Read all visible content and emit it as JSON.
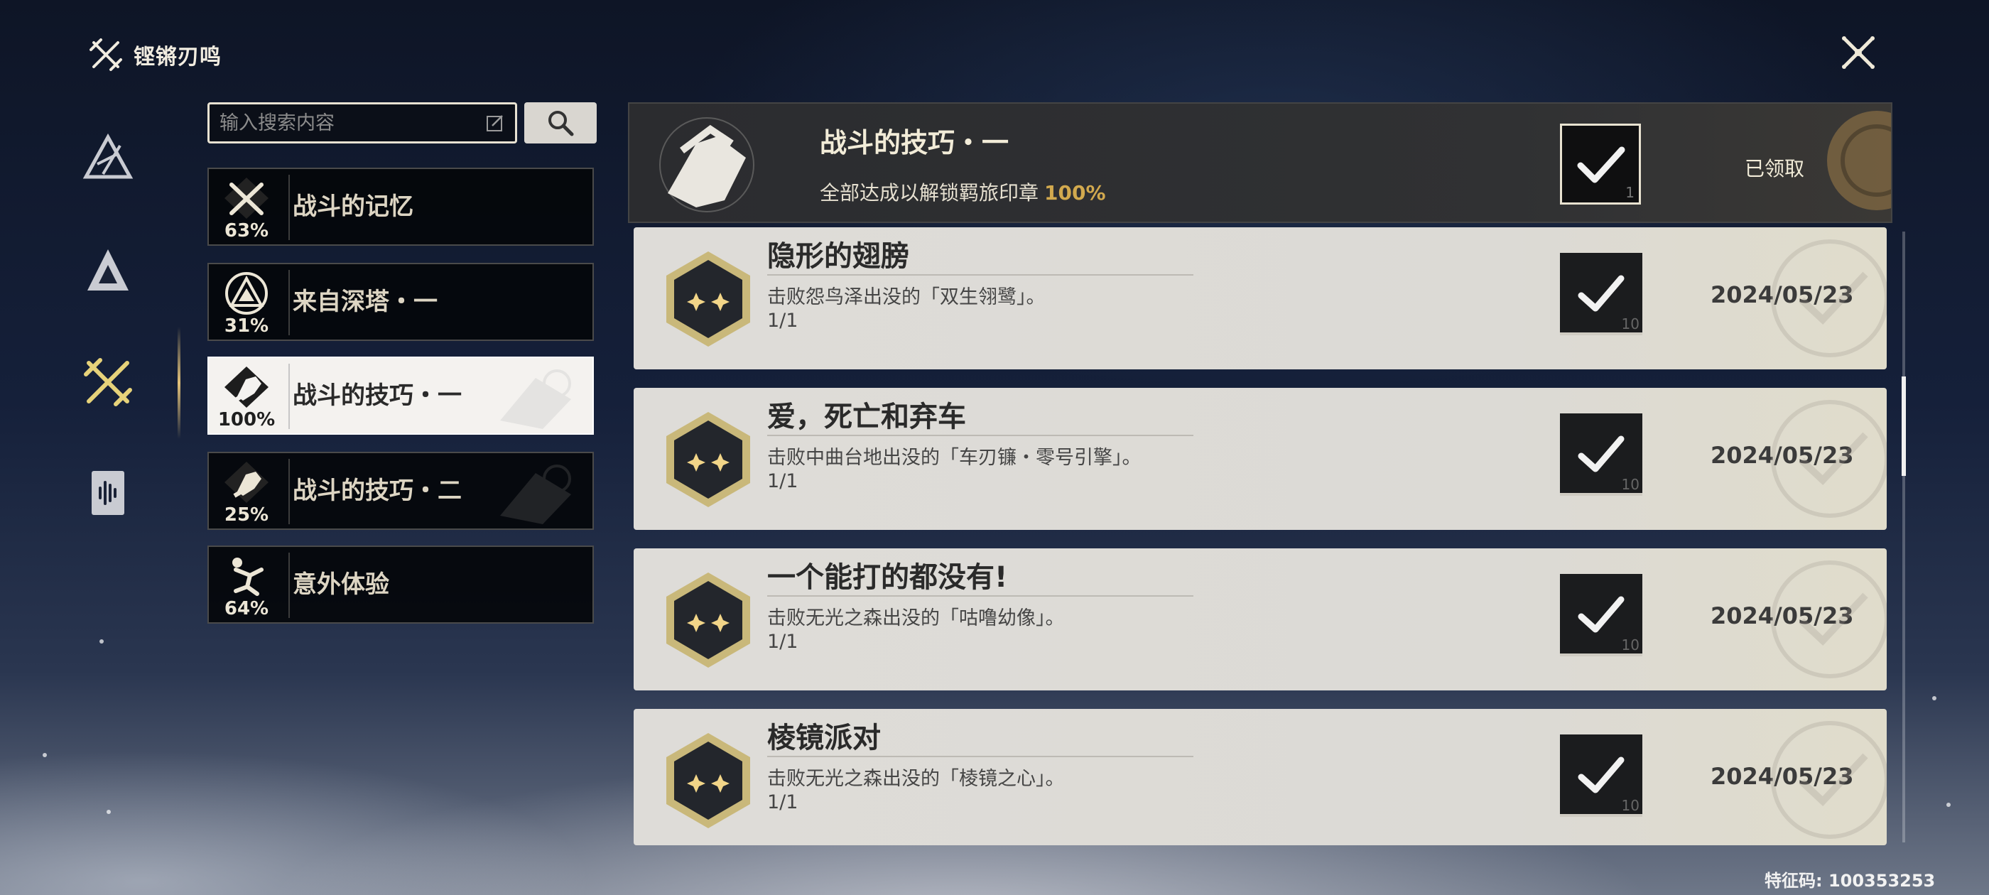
{
  "header": {
    "title": "铿锵刃鸣",
    "app_icon": "crossed-swords-icon",
    "close_icon": "close-x-icon"
  },
  "rail": {
    "items": [
      {
        "icon": "triangle-emblem-icon",
        "active": false
      },
      {
        "icon": "mountain-emblem-icon",
        "active": false
      },
      {
        "icon": "crossed-swords-icon",
        "active": true
      },
      {
        "icon": "soundwave-card-icon",
        "active": false
      }
    ]
  },
  "search": {
    "placeholder": "输入搜索内容",
    "icon": "search-icon"
  },
  "categories": [
    {
      "label": "战斗的记忆",
      "pct": "63%",
      "icon": "swords-icon",
      "active": false
    },
    {
      "label": "来自深塔・一",
      "pct": "31%",
      "icon": "tower-icon",
      "active": false
    },
    {
      "label": "战斗的技巧・一",
      "pct": "100%",
      "icon": "fist-icon",
      "active": true
    },
    {
      "label": "战斗的技巧・二",
      "pct": "25%",
      "icon": "fist-icon",
      "active": false
    },
    {
      "label": "意外体验",
      "pct": "64%",
      "icon": "falling-figure-icon",
      "active": false
    }
  ],
  "summary": {
    "title": "战斗的技巧・一",
    "desc": "全部达成以解锁羁旅印章",
    "pct": "100%",
    "count": "1",
    "status": "已领取"
  },
  "achievements": [
    {
      "title": "隐形的翅膀",
      "desc": "击败怨鸟泽出没的「双生翎鹭」。",
      "progress": "1/1",
      "count": "10",
      "date": "2024/05/23"
    },
    {
      "title": "爱，死亡和弃车",
      "desc": "击败中曲台地出没的「车刃镰・零号引擎」。",
      "progress": "1/1",
      "count": "10",
      "date": "2024/05/23"
    },
    {
      "title": "一个能打的都没有!",
      "desc": "击败无光之森出没的「咕噜幼像」。",
      "progress": "1/1",
      "count": "10",
      "date": "2024/05/23"
    },
    {
      "title": "棱镜派对",
      "desc": "击败无光之森出没的「棱镜之心」。",
      "progress": "1/1",
      "count": "10",
      "date": "2024/05/23"
    }
  ],
  "footer": {
    "uid": "特征码: 100353253"
  },
  "colors": {
    "accent_gold": "#d2a94e",
    "card_light": "#dedcd8",
    "card_dark": "#04060a"
  }
}
